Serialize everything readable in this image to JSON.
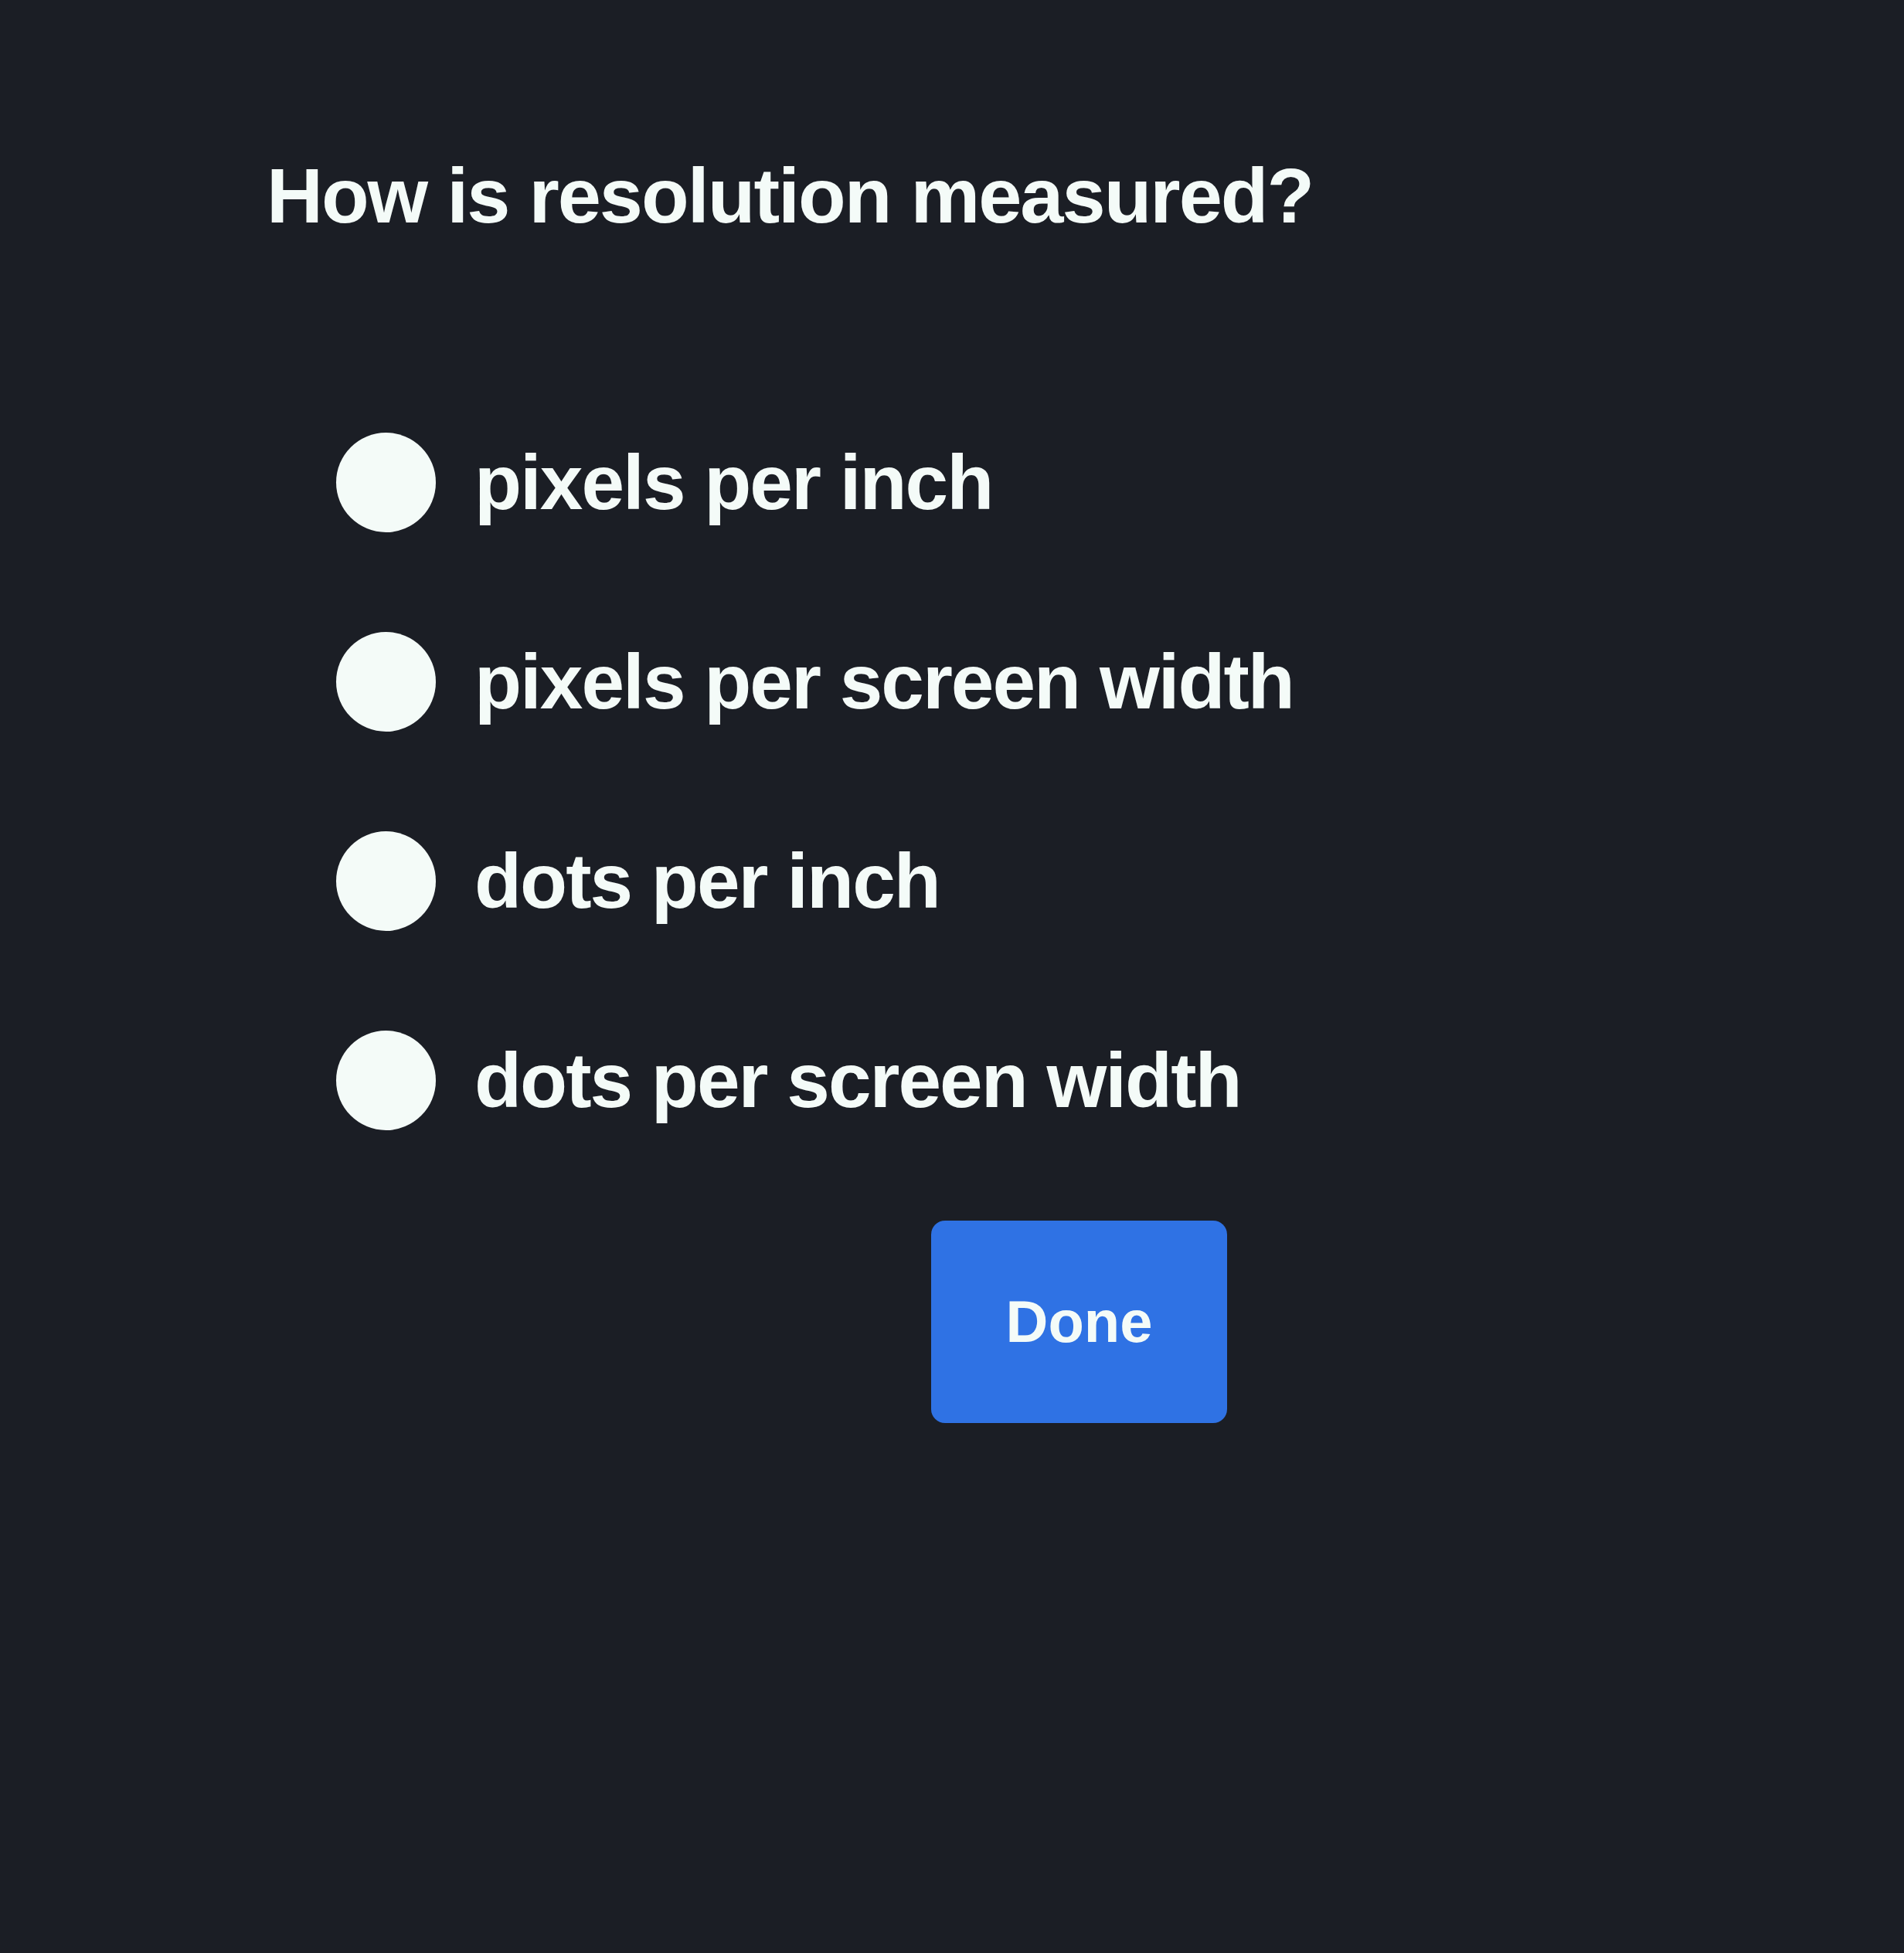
{
  "question": "How is resolution measured?",
  "options": [
    {
      "label": "pixels per inch",
      "selected": false
    },
    {
      "label": "pixels per screen width",
      "selected": false
    },
    {
      "label": "dots per inch",
      "selected": false
    },
    {
      "label": "dots per screen width",
      "selected": false
    }
  ],
  "done_button": {
    "label": "Done"
  }
}
